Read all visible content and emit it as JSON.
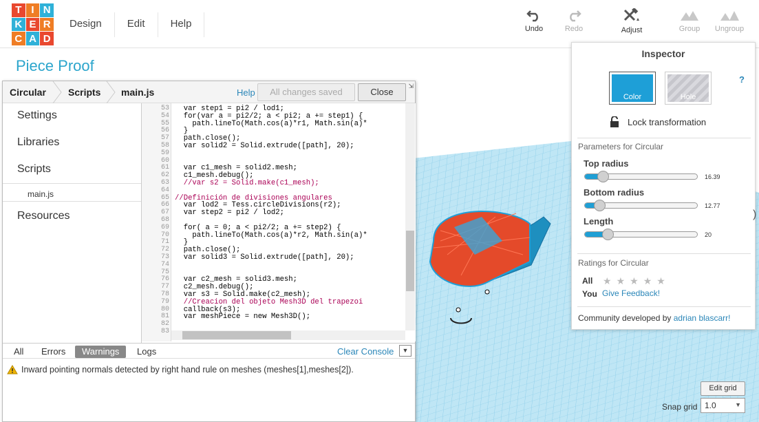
{
  "logo": {
    "letters": [
      "T",
      "I",
      "N",
      "K",
      "E",
      "R",
      "C",
      "A",
      "D"
    ],
    "colors": [
      "#e9482f",
      "#ef7d25",
      "#2fb1d8",
      "#2fb1d8",
      "#e9482f",
      "#ef7d25",
      "#ef7d25",
      "#2fb1d8",
      "#e9482f"
    ]
  },
  "menu": [
    "Design",
    "Edit",
    "Help"
  ],
  "toolbar": {
    "undo": "Undo",
    "redo": "Redo",
    "adjust": "Adjust",
    "group": "Group",
    "ungroup": "Ungroup"
  },
  "page_title": "Piece Proof",
  "editor": {
    "breadcrumbs": [
      "Circular",
      "Scripts",
      "main.js"
    ],
    "help": "Help",
    "saved": "All changes saved",
    "close": "Close",
    "resize_glyph": "⇲"
  },
  "sidebar": {
    "items": [
      "Settings",
      "Libraries",
      "Scripts",
      "main.js",
      "Resources"
    ]
  },
  "code": {
    "line_numbers": [
      "53",
      "54",
      "55",
      "56",
      "57",
      "58",
      "59",
      "60",
      "61",
      "62",
      "63",
      "64",
      "65",
      "66",
      "67",
      "68",
      "69",
      "70",
      "71",
      "72",
      "73",
      "74",
      "75",
      "76",
      "77",
      "78",
      "79",
      "80",
      "81",
      "82",
      "83"
    ],
    "lines": [
      "  var step1 = pi2 / lod1;",
      "  for(var a = pi2/2; a < pi2; a += step1) {",
      "    path.lineTo(Math.cos(a)*r1, Math.sin(a)*",
      "  }",
      "  path.close();",
      "  var solid2 = Solid.extrude([path], 20);",
      "",
      "",
      "  var c1_mesh = solid2.mesh;",
      "  c1_mesh.debug();",
      "  //var s2 = Solid.make(c1_mesh);",
      "",
      "//Definición de divisiones angulares",
      "  var lod2 = Tess.circleDivisions(r2);",
      "  var step2 = pi2 / lod2;",
      "",
      "  for( a = 0; a < pi2/2; a += step2) {",
      "    path.lineTo(Math.cos(a)*r2, Math.sin(a)*",
      "  }",
      "  path.close();",
      "  var solid3 = Solid.extrude([path], 20);",
      "",
      "",
      "  var c2_mesh = solid3.mesh;",
      "  c2_mesh.debug();",
      "  var s3 = Solid.make(c2_mesh);",
      "  //Creacion del objeto Mesh3D del trapezoi",
      "  callback(s3);",
      "  var meshPiece = new Mesh3D();",
      "",
      ""
    ]
  },
  "console": {
    "tabs": [
      "All",
      "Errors",
      "Warnings",
      "Logs"
    ],
    "active_tab": "Warnings",
    "clear": "Clear Console",
    "message": "Inward pointing normals detected by right hand rule on meshes (meshes[1],meshes[2])."
  },
  "inspector": {
    "title": "Inspector",
    "color_label": "Color",
    "hole_label": "Hole",
    "color_value": "#1e9fd7",
    "help": "?",
    "lock": "Lock transformation",
    "params_header": "Parameters for Circular",
    "params": [
      {
        "label": "Top radius",
        "value": "16.39",
        "fraction": 0.16
      },
      {
        "label": "Bottom radius",
        "value": "12.77",
        "fraction": 0.13
      },
      {
        "label": "Length",
        "value": "20",
        "fraction": 0.2
      }
    ],
    "ratings_header": "Ratings for Circular",
    "all_label": "All",
    "stars": 5,
    "you_label": "You",
    "feedback": "Give Feedback!",
    "community_prefix": "Community developed by",
    "author": "adrian blascarr!"
  },
  "grid_controls": {
    "edit_grid": "Edit grid",
    "snap_label": "Snap grid",
    "snap_value": "1.0"
  }
}
